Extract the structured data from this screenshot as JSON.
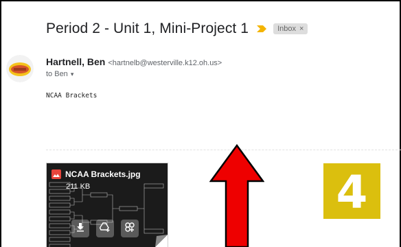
{
  "email": {
    "subject": "Period 2 - Unit 1, Mini-Project 1",
    "label": "Inbox",
    "label_close": "×",
    "sender_name": "Hartnell, Ben",
    "sender_email": "<hartnelb@westerville.k12.oh.us>",
    "recipient": "to Ben",
    "recipient_caret": "▾",
    "body": "NCAA Brackets"
  },
  "attachment": {
    "filename": "NCAA Brackets.jpg",
    "size": "211 KB",
    "actions": [
      "download-icon",
      "add-to-drive-icon",
      "edit-with-photos-icon"
    ]
  },
  "overlay": {
    "number": "4",
    "badge_color": "#dbbf0e",
    "arrow_color": "#ee0000"
  },
  "colors": {
    "important_marker": "#f4b400",
    "attachment_bg": "#1b1b1b"
  }
}
